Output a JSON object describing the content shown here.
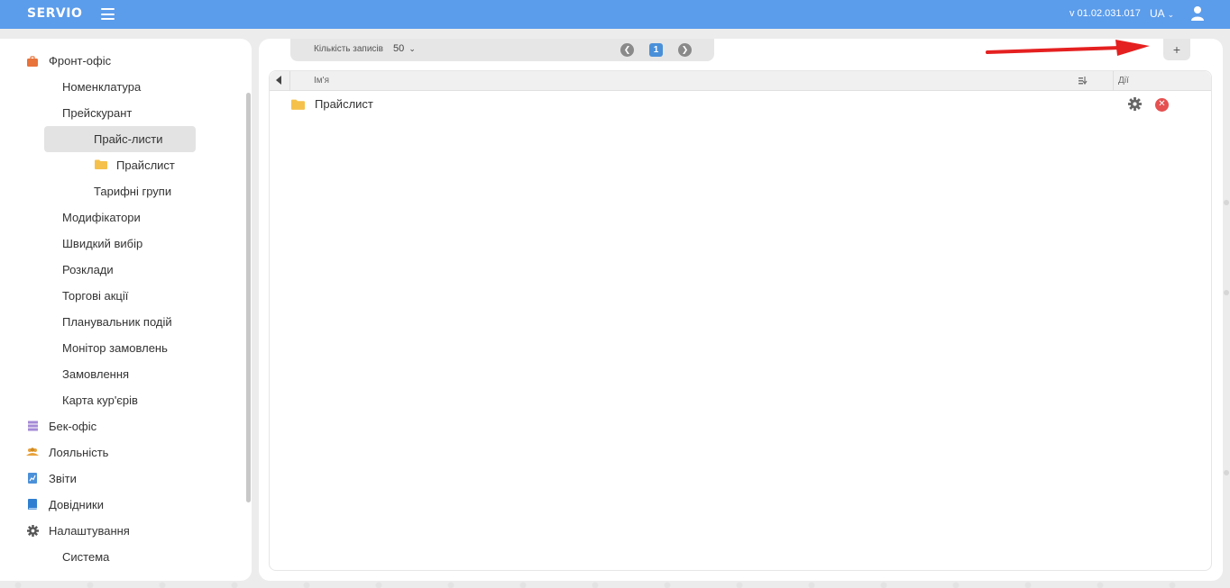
{
  "header": {
    "brand": "SERVIO",
    "version": "v 01.02.031.017",
    "language": "UA"
  },
  "sidebar": {
    "items": [
      {
        "label": "Фронт-офіс",
        "icon": "briefcase-icon",
        "color": "#e8733b"
      },
      {
        "label": "Номенклатура"
      },
      {
        "label": "Прейскурант"
      },
      {
        "label": "Прайс-листи",
        "selected": true
      },
      {
        "label": "Прайслист",
        "icon": "folder-icon",
        "color": "#f5c14b"
      },
      {
        "label": "Тарифні групи"
      },
      {
        "label": "Модифікатори"
      },
      {
        "label": "Швидкий вибір"
      },
      {
        "label": "Розклади"
      },
      {
        "label": "Торгові акції"
      },
      {
        "label": "Планувальник подій"
      },
      {
        "label": "Монітор замовлень"
      },
      {
        "label": "Замовлення"
      },
      {
        "label": "Карта кур'єрів"
      },
      {
        "label": "Бек-офіс",
        "icon": "stack-icon",
        "color": "#a58ad6"
      },
      {
        "label": "Лояльність",
        "icon": "people-icon",
        "color": "#e8a23b"
      },
      {
        "label": "Звіти",
        "icon": "report-icon",
        "color": "#4a90d9"
      },
      {
        "label": "Довідники",
        "icon": "book-icon",
        "color": "#2f7fd0"
      },
      {
        "label": "Налаштування",
        "icon": "gear-icon",
        "color": "#555555"
      },
      {
        "label": "Система"
      }
    ]
  },
  "toolbar": {
    "records_label": "Кількість записів",
    "records_value": "50",
    "current_page": "1",
    "add_label": "+"
  },
  "table": {
    "col_name": "Ім'я",
    "col_actions": "Дії",
    "rows": [
      {
        "name": "Прайслист"
      }
    ]
  },
  "colors": {
    "topbar": "#5b9ceb",
    "accent": "#4a90d9",
    "delete": "#e55050",
    "arrow": "#e52020"
  }
}
